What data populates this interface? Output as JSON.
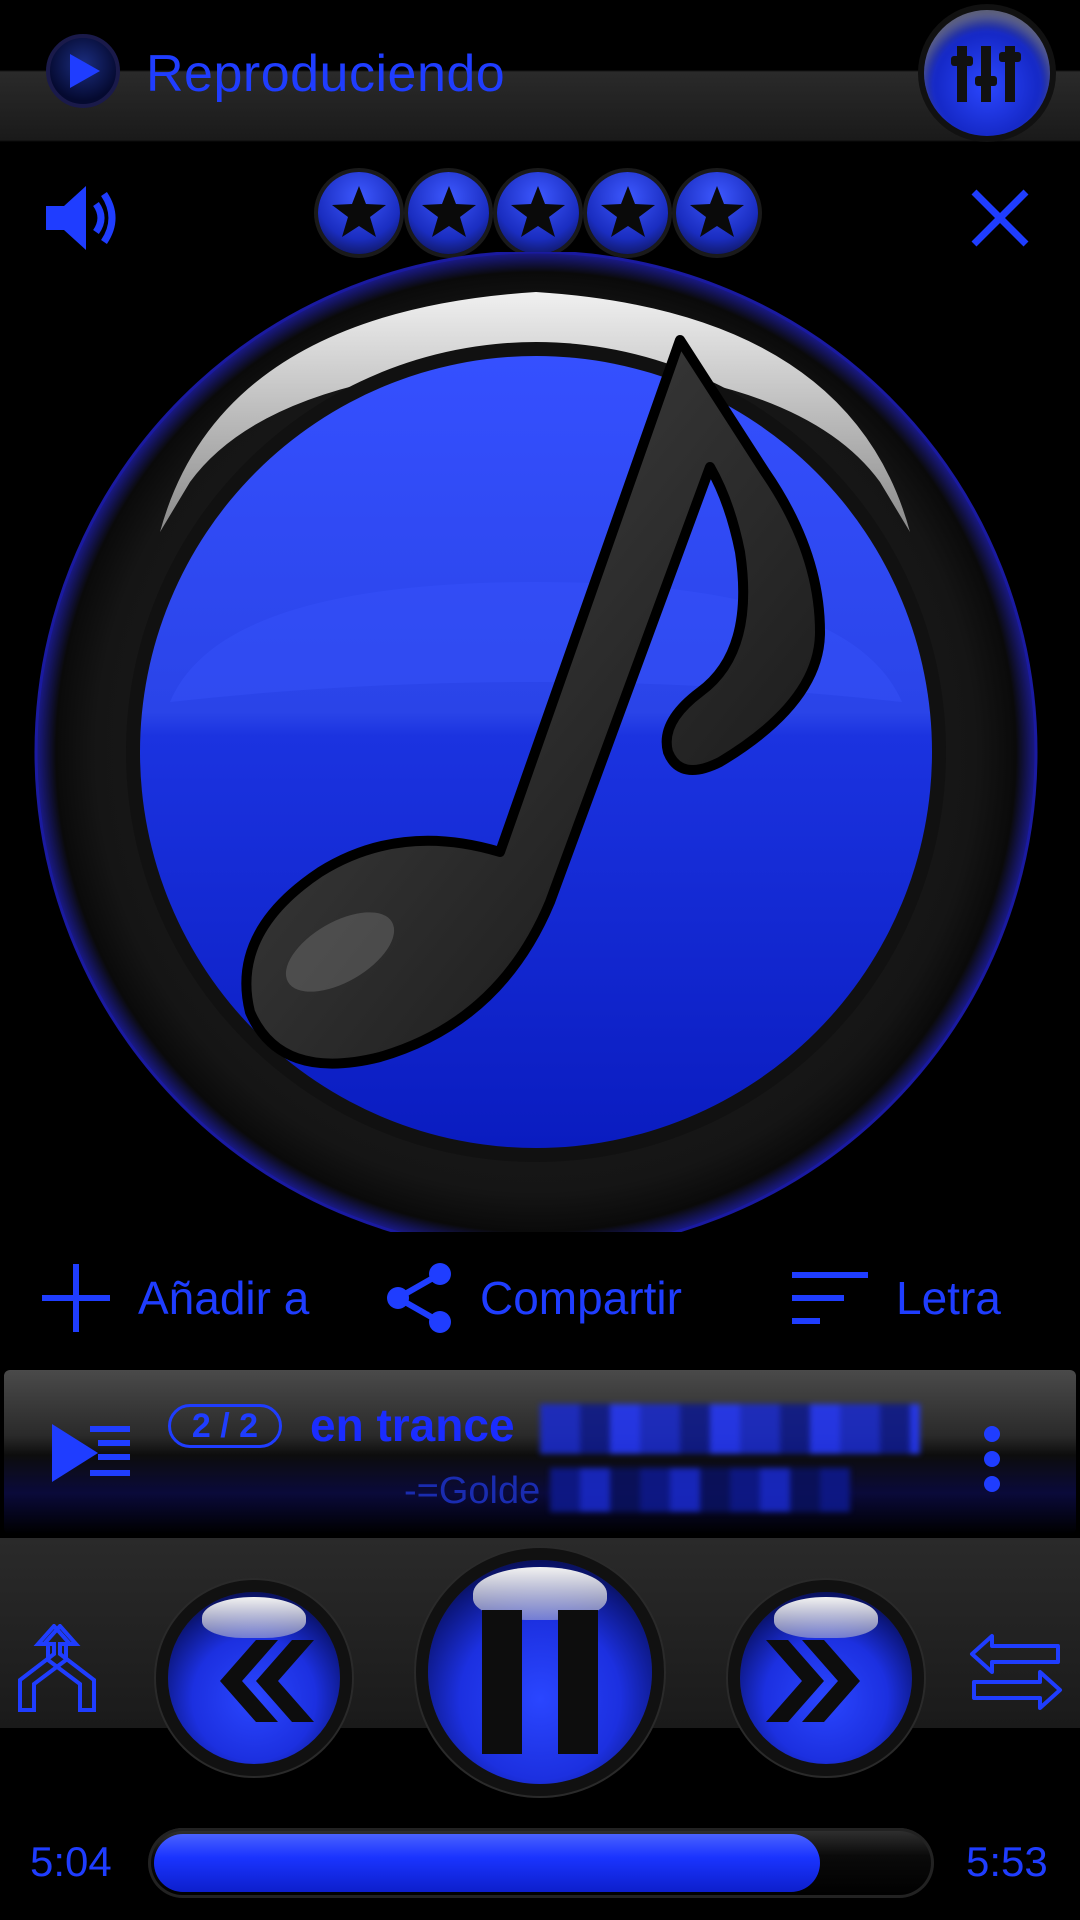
{
  "header": {
    "title": "Reproduciendo",
    "play_badge_icon": "play-icon",
    "equalizer_icon": "equalizer-icon"
  },
  "toolbar": {
    "volume_icon": "volume-icon",
    "rating": {
      "stars_filled": 5,
      "max": 5
    },
    "close_icon": "close-icon"
  },
  "album_art": {
    "icon": "music-note-icon"
  },
  "actions": [
    {
      "label": "Añadir a",
      "icon": "plus-icon"
    },
    {
      "label": "Compartir",
      "icon": "share-icon"
    },
    {
      "label": "Letra",
      "icon": "lyrics-icon"
    }
  ],
  "now_playing": {
    "counter": "2 / 2",
    "title": "en trance",
    "artist": "-=Golde"
  },
  "controls": {
    "shuffle_icon": "shuffle-icon",
    "prev_icon": "rewind-icon",
    "pause_icon": "pause-icon",
    "next_icon": "fast-forward-icon",
    "repeat_icon": "repeat-icon"
  },
  "progress": {
    "elapsed": "5:04",
    "total": "5:53",
    "fraction": 0.861
  },
  "colors": {
    "accent": "#1f3dff",
    "background": "#000000"
  }
}
